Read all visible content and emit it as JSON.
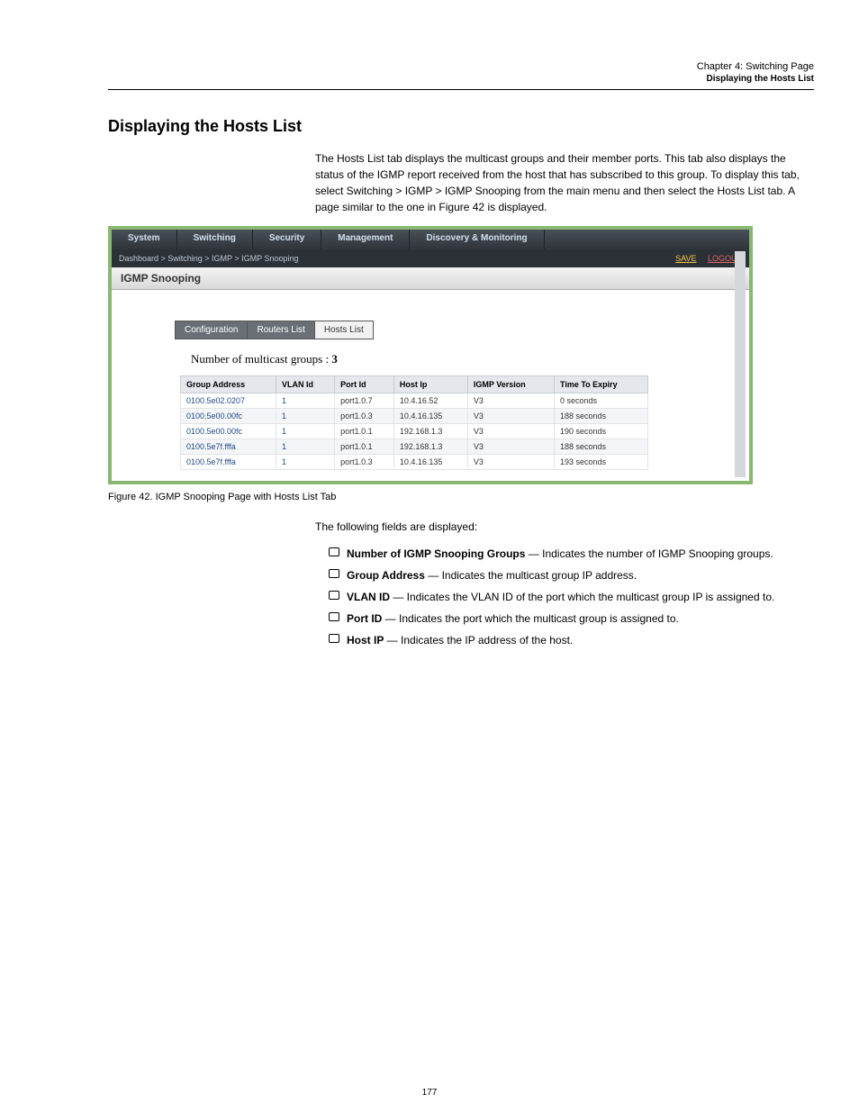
{
  "header": {
    "running_title": "Chapter 4: Switching Page",
    "chapter_num": "Displaying the Hosts List"
  },
  "section_title": "Displaying the Hosts List",
  "intro": "The Hosts List tab displays the multicast groups and their member ports. This tab also displays the status of the IGMP report received from the host that has subscribed to this group. To display this tab, select Switching > IGMP > IGMP Snooping from the main menu and then select the Hosts List tab. A page similar to the one in Figure 42 is displayed.",
  "ui": {
    "topnav": [
      "System",
      "Switching",
      "Security",
      "Management",
      "Discovery & Monitoring"
    ],
    "breadcrumb": "Dashboard  >  Switching  >  IGMP >  IGMP Snooping",
    "save": "SAVE",
    "logout": "LOGOUT",
    "panel_title": "IGMP Snooping",
    "subtabs": [
      "Configuration",
      "Routers List",
      "Hosts List"
    ],
    "mc_label": "Number of multicast groups :  ",
    "mc_value": "3",
    "cols": [
      "Group Address",
      "VLAN Id",
      "Port Id",
      "Host Ip",
      "IGMP Version",
      "Time To Expiry"
    ],
    "rows": [
      [
        "0100.5e02.0207",
        "1",
        "port1.0.7",
        "10.4.16.52",
        "V3",
        "0 seconds"
      ],
      [
        "0100.5e00.00fc",
        "1",
        "port1.0.3",
        "10.4.16.135",
        "V3",
        "188 seconds"
      ],
      [
        "0100.5e00.00fc",
        "1",
        "port1.0.1",
        "192.168.1.3",
        "V3",
        "190 seconds"
      ],
      [
        "0100.5e7f.fffa",
        "1",
        "port1.0.1",
        "192.168.1.3",
        "V3",
        "188 seconds"
      ],
      [
        "0100.5e7f.fffa",
        "1",
        "port1.0.3",
        "10.4.16.135",
        "V3",
        "193 seconds"
      ]
    ]
  },
  "fig_caption": "Figure 42. IGMP Snooping Page with Hosts List Tab",
  "desc_intro": "The following fields are displayed:",
  "bullets": [
    {
      "head": "Number of IGMP Snooping Groups",
      "tail": " — Indicates the number of IGMP Snooping groups."
    },
    {
      "head": "Group Address",
      "tail": " — Indicates the multicast group IP address."
    },
    {
      "head": "VLAN ID",
      "tail": " — Indicates the VLAN ID of the port which the multicast group IP is assigned to."
    },
    {
      "head": "Port ID",
      "tail": " — Indicates the port which the multicast group is assigned to."
    },
    {
      "head": "Host IP",
      "tail": " — Indicates the IP address of the host."
    }
  ],
  "page_num": "177"
}
